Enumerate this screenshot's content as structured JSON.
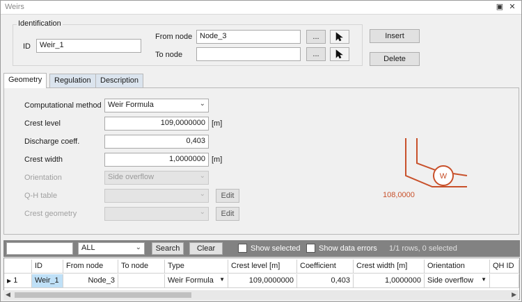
{
  "window": {
    "title": "Weirs",
    "restore_icon": "restore-icon",
    "close_icon": "close-icon"
  },
  "identification": {
    "legend": "Identification",
    "id_label": "ID",
    "id_value": "Weir_1",
    "from_node_label": "From node",
    "from_node_value": "Node_3",
    "to_node_label": "To node",
    "to_node_value": "",
    "browse_label": "...",
    "insert_label": "Insert",
    "delete_label": "Delete"
  },
  "tabs": [
    {
      "label": "Geometry",
      "active": true
    },
    {
      "label": "Regulation",
      "active": false
    },
    {
      "label": "Description",
      "active": false
    }
  ],
  "geometry": {
    "computational_method_label": "Computational method",
    "computational_method_value": "Weir Formula",
    "crest_level_label": "Crest level",
    "crest_level_value": "109,0000000",
    "crest_level_unit": "[m]",
    "discharge_coeff_label": "Discharge coeff.",
    "discharge_coeff_value": "0,403",
    "crest_width_label": "Crest width",
    "crest_width_value": "1,0000000",
    "crest_width_unit": "[m]",
    "orientation_label": "Orientation",
    "orientation_value": "Side overflow",
    "qh_table_label": "Q-H table",
    "qh_table_value": "",
    "crest_geometry_label": "Crest geometry",
    "crest_geometry_value": "",
    "edit_label": "Edit",
    "diagram_symbol": "W",
    "diagram_level": "108,0000",
    "diagram_color": "#c8502a"
  },
  "toolbar": {
    "search_value": "",
    "filter_value": "ALL",
    "search_label": "Search",
    "clear_label": "Clear",
    "show_selected_label": "Show selected",
    "show_data_errors_label": "Show data errors",
    "status": "1/1 rows, 0 selected"
  },
  "table": {
    "columns": [
      "ID",
      "From node",
      "To node",
      "Type",
      "Crest level [m]",
      "Coefficient",
      "Crest width [m]",
      "Orientation",
      "QH ID"
    ],
    "rows": [
      {
        "index": "1",
        "id": "Weir_1",
        "from_node": "Node_3",
        "to_node": "",
        "type": "Weir Formula",
        "crest_level": "109,0000000",
        "coefficient": "0,403",
        "crest_width": "1,0000000",
        "orientation": "Side overflow",
        "qh_id": ""
      }
    ]
  }
}
